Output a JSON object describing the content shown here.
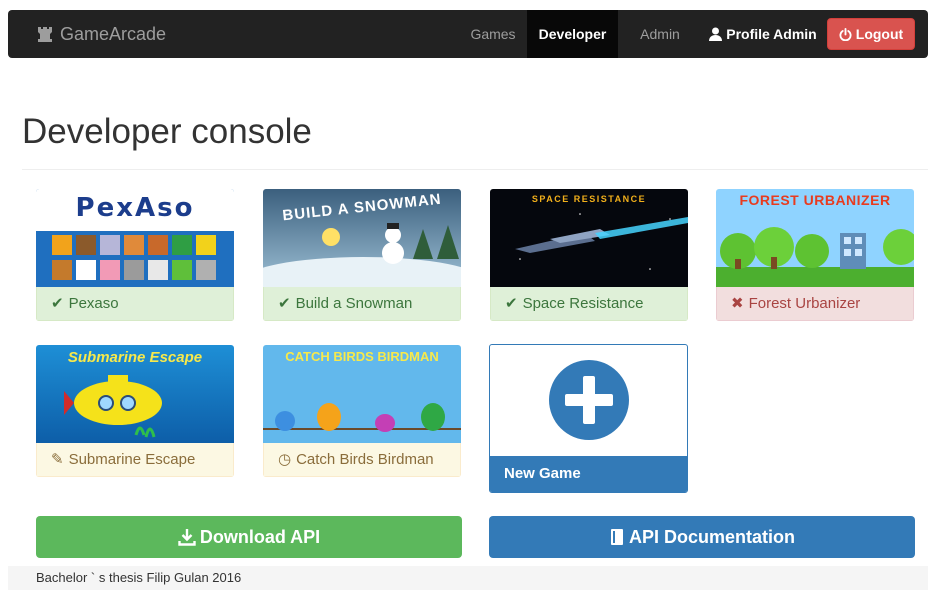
{
  "navbar": {
    "brand": "GameArcade",
    "items": [
      {
        "label": "Games"
      },
      {
        "label": "Developer"
      },
      {
        "label": "Admin"
      }
    ],
    "profile_label": "Profile Admin",
    "logout_label": "Logout"
  },
  "page": {
    "title": "Developer console"
  },
  "games": [
    {
      "name": "Pexaso",
      "status": "approved",
      "icon": "check-icon",
      "thumb_title": "PexAso"
    },
    {
      "name": "Build a Snowman",
      "status": "approved",
      "icon": "check-icon",
      "thumb_title": "BUILD A SNOWMAN"
    },
    {
      "name": "Space Resistance",
      "status": "approved",
      "icon": "check-icon",
      "thumb_title": "SPACE RESISTANCE"
    },
    {
      "name": "Forest Urbanizer",
      "status": "rejected",
      "icon": "cross-icon",
      "thumb_title": "FOREST URBANIZER"
    },
    {
      "name": "Submarine Escape",
      "status": "editing",
      "icon": "pencil-icon",
      "thumb_title": "Submarine Escape"
    },
    {
      "name": "Catch Birds Birdman",
      "status": "pending",
      "icon": "clock-icon",
      "thumb_title": "CATCH BIRDS BIRDMAN"
    }
  ],
  "new_game": {
    "label": "New Game"
  },
  "buttons": {
    "download_api": "Download API",
    "api_docs": "API Documentation"
  },
  "footer": {
    "text": "Bachelor ` s thesis Filip Gulan 2016"
  },
  "colors": {
    "navbar": "#222222",
    "active_nav": "#080808",
    "primary": "#337ab7",
    "success": "#5cb85c",
    "danger": "#d9534f"
  }
}
